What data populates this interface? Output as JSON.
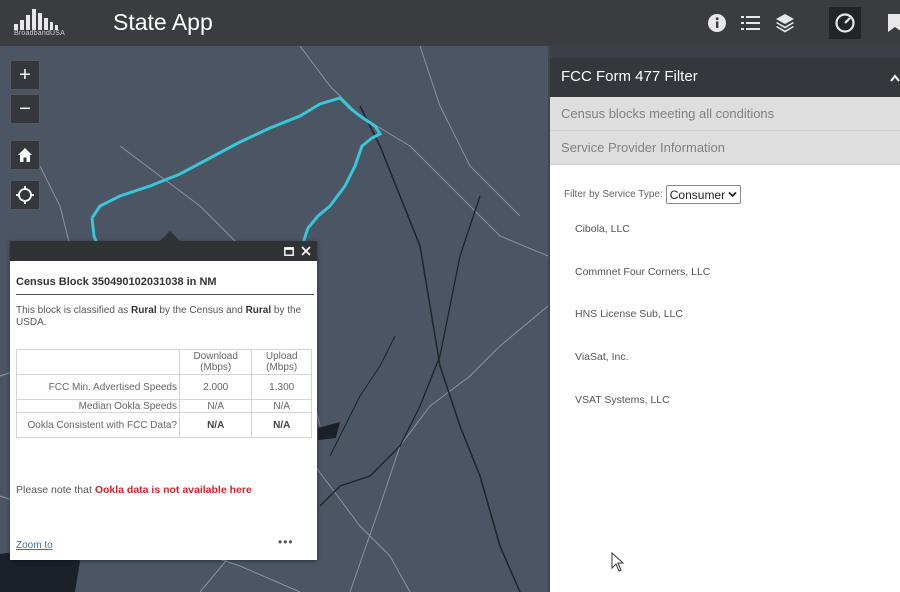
{
  "header": {
    "logo_text": "BroadbandUSA",
    "app_title": "State App",
    "icons": [
      "info-icon",
      "list-icon",
      "layers-icon",
      "gauge-icon",
      "bookmark-icon"
    ]
  },
  "map": {
    "controls": [
      "zoom-in",
      "zoom-out",
      "home",
      "locate"
    ],
    "zoom_in_label": "+",
    "zoom_out_label": "−"
  },
  "popup": {
    "title": "Census Block 350490102031038 in NM",
    "desc_prefix": "This block is classified as ",
    "desc_rural1": "Rural",
    "desc_mid": " by the Census and ",
    "desc_rural2": "Rural",
    "desc_suffix": " by the USDA.",
    "table": {
      "col_download": "Download (Mbps)",
      "col_upload": "Upload (Mbps)",
      "rows": [
        {
          "label": "FCC Min. Advertised Speeds",
          "download": "2.000",
          "upload": "1.300"
        },
        {
          "label": "Median Ookla Speeds",
          "download": "N/A",
          "upload": "N/A"
        },
        {
          "label": "Ookla Consistent with FCC Data?",
          "download": "N/A",
          "upload": "N/A"
        }
      ]
    },
    "note_prefix": "Please note that ",
    "note_red": "Ookla data is not available here",
    "zoom_link": "Zoom to",
    "more": "•••"
  },
  "panel": {
    "title": "FCC Form 477 Filter",
    "section1": "Census blocks meeting all conditions",
    "section2": "Service Provider Information",
    "filter_label": "Filter by Service Type:",
    "filter_value": "Consumer",
    "providers": [
      "Cibola, LLC",
      "Commnet Four Corners, LLC",
      "HNS License Sub, LLC",
      "ViaSat, Inc.",
      "VSAT Systems, LLC"
    ]
  }
}
